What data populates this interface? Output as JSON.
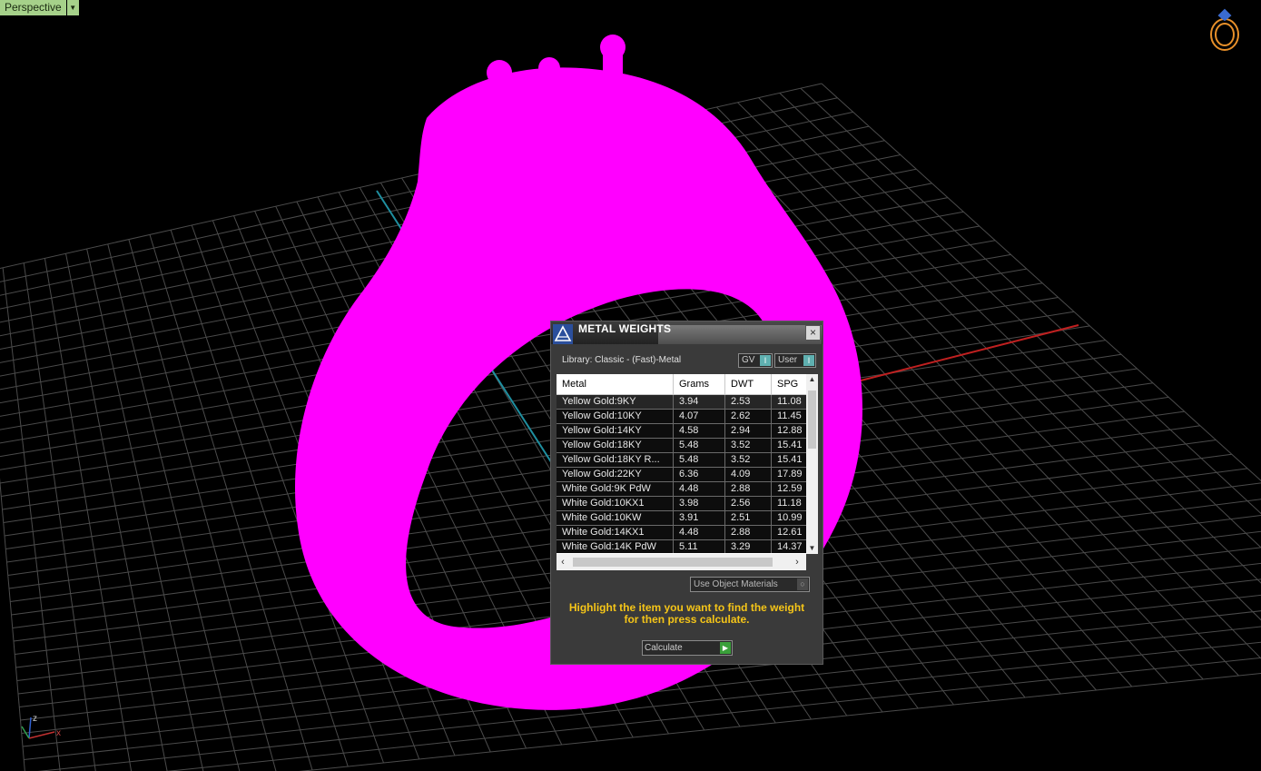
{
  "viewport": {
    "label": "Perspective",
    "axis_labels": {
      "z": "z",
      "x": "x"
    },
    "icons": [
      "chevron-down-icon",
      "ring-navigation-icon",
      "axis-gizmo-icon"
    ],
    "colors": {
      "model": "#ff00ff",
      "grid": "#4a4a4a",
      "x_axis": "#c02020",
      "y_axis": "#1f8fa0"
    }
  },
  "dialog": {
    "title": "METAL WEIGHTS",
    "close_symbol": "×",
    "library_label": "Library: Classic - (Fast)-Metal",
    "toggles": [
      {
        "label": "GV",
        "knob": "I"
      },
      {
        "label": "User",
        "knob": "I"
      }
    ],
    "table": {
      "columns": [
        "Metal",
        "Grams",
        "DWT",
        "SPG"
      ],
      "rows": [
        [
          "Yellow Gold:9KY",
          "3.94",
          "2.53",
          "11.08"
        ],
        [
          "Yellow Gold:10KY",
          "4.07",
          "2.62",
          "11.45"
        ],
        [
          "Yellow Gold:14KY",
          "4.58",
          "2.94",
          "12.88"
        ],
        [
          "Yellow Gold:18KY",
          "5.48",
          "3.52",
          "15.41"
        ],
        [
          "Yellow Gold:18KY R...",
          "5.48",
          "3.52",
          "15.41"
        ],
        [
          "Yellow Gold:22KY",
          "6.36",
          "4.09",
          "17.89"
        ],
        [
          "White Gold:9K PdW",
          "4.48",
          "2.88",
          "12.59"
        ],
        [
          "White Gold:10KX1",
          "3.98",
          "2.56",
          "11.18"
        ],
        [
          "White Gold:10KW",
          "3.91",
          "2.51",
          "10.99"
        ],
        [
          "White Gold:14KX1",
          "4.48",
          "2.88",
          "12.61"
        ],
        [
          "White Gold:14K PdW",
          "5.11",
          "3.29",
          "14.37"
        ]
      ]
    },
    "use_object_materials": "Use Object Materials",
    "hint_line1": "Highlight the item you want to find the weight",
    "hint_line2": "for then press calculate.",
    "calculate": "Calculate"
  }
}
